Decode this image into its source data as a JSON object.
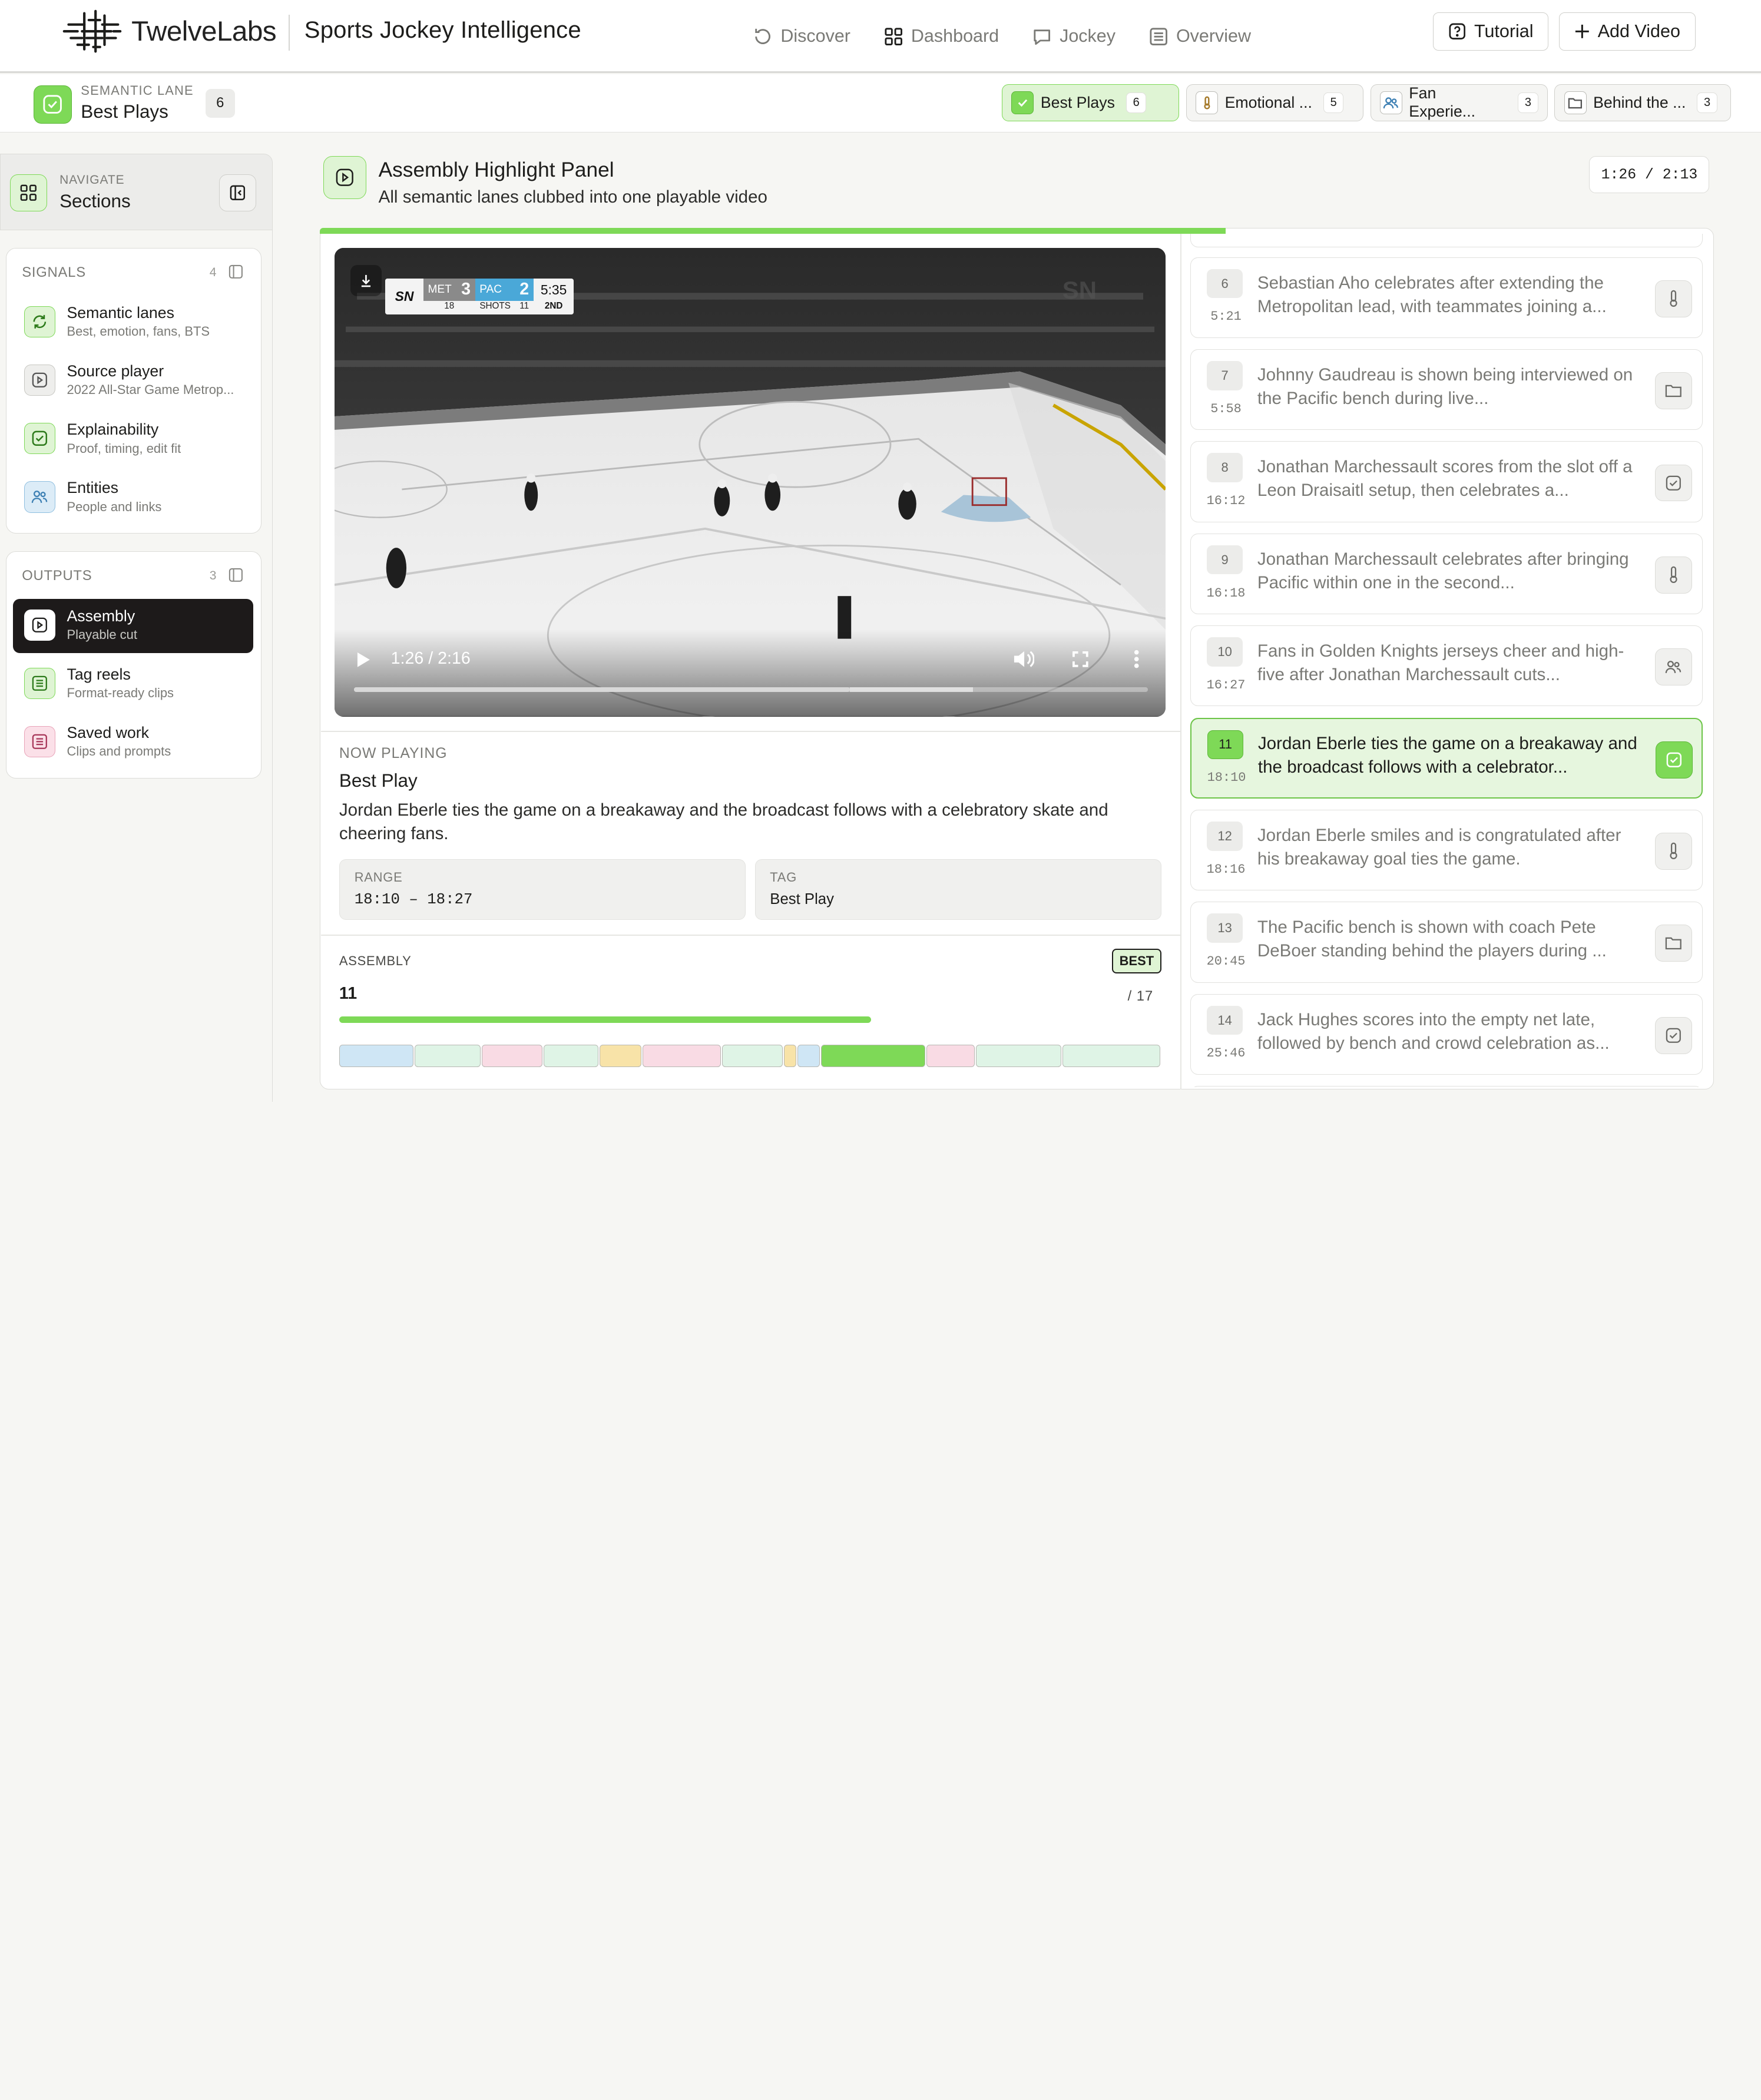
{
  "brand": {
    "name": "TwelveLabs",
    "app_title": "Sports Jockey Intelligence"
  },
  "nav": [
    {
      "label": "Discover",
      "icon": "refresh-chat-icon",
      "active": false
    },
    {
      "label": "Dashboard",
      "icon": "grid-icon",
      "active": true
    },
    {
      "label": "Jockey",
      "icon": "chat-bubble-icon",
      "active": false
    },
    {
      "label": "Overview",
      "icon": "list-icon",
      "active": false
    }
  ],
  "header_buttons": {
    "tutorial": "Tutorial",
    "add_video": "Add Video"
  },
  "lane": {
    "caption": "SEMANTIC LANE",
    "name": "Best Plays",
    "count": "6"
  },
  "lane_chips": [
    {
      "label": "Best Plays",
      "count": "6",
      "icon": "check-square-icon",
      "active": true
    },
    {
      "label": "Emotional ...",
      "count": "5",
      "icon": "thermometer-icon",
      "active": false
    },
    {
      "label": "Fan Experie...",
      "count": "3",
      "icon": "users-icon",
      "active": false
    },
    {
      "label": "Behind the ...",
      "count": "3",
      "icon": "folder-icon",
      "active": false
    }
  ],
  "sidebar": {
    "nav_caption": "NAVIGATE",
    "nav_title": "Sections",
    "signals": {
      "caption": "SIGNALS",
      "count": "4",
      "items": [
        {
          "title": "Semantic lanes",
          "subtitle": "Best, emotion, fans, BTS",
          "icon": "refresh-icon"
        },
        {
          "title": "Source player",
          "subtitle": "2022 All-Star Game Metrop...",
          "icon": "play-square-icon"
        },
        {
          "title": "Explainability",
          "subtitle": "Proof, timing, edit fit",
          "icon": "check-square-icon"
        },
        {
          "title": "Entities",
          "subtitle": "People and links",
          "icon": "users-icon"
        }
      ]
    },
    "outputs": {
      "caption": "OUTPUTS",
      "count": "3",
      "items": [
        {
          "title": "Assembly",
          "subtitle": "Playable cut",
          "icon": "play-square-icon",
          "active": true
        },
        {
          "title": "Tag reels",
          "subtitle": "Format-ready clips",
          "icon": "list-icon",
          "active": false
        },
        {
          "title": "Saved work",
          "subtitle": "Clips and prompts",
          "icon": "list-icon",
          "active": false
        }
      ]
    }
  },
  "panel": {
    "title": "Assembly Highlight Panel",
    "subtitle": "All semantic lanes clubbed into one playable video",
    "time": "1:26 / 2:13"
  },
  "video": {
    "time": "1:26 / 2:16",
    "progress": 0.625,
    "buffered": 0.78,
    "scorebug": {
      "network": "SN",
      "team1": "MET",
      "score1": "3",
      "team2": "PAC",
      "score2": "2",
      "clock": "5:35",
      "shots1": "18",
      "shots_label": "SHOTS",
      "shots2": "11",
      "period": "2ND"
    }
  },
  "now_playing": {
    "caption": "NOW PLAYING",
    "title": "Best Play",
    "description": "Jordan Eberle ties the game on a breakaway and the broadcast follows with a celebratory skate and cheering fans.",
    "range_label": "RANGE",
    "range_value": "18:10 – 18:27",
    "tag_label": "TAG",
    "tag_value": "Best Play"
  },
  "assembly": {
    "caption": "ASSEMBLY",
    "badge": "BEST",
    "current": "11",
    "total": "/ 17",
    "progress": 0.647,
    "segments": [
      {
        "color": "#cfe6f5"
      },
      {
        "color": "#dff4e6"
      },
      {
        "color": "#f9dbe4"
      },
      {
        "color": "#dff4e6"
      },
      {
        "color": "#f8e3a8"
      },
      {
        "color": "#f9dbe4"
      },
      {
        "color": "#dff4e6"
      },
      {
        "color": "#f8e3a8"
      },
      {
        "color": "#cfe6f5"
      },
      {
        "color": "#7ed957"
      },
      {
        "color": "#f9dbe4"
      },
      {
        "color": "#dff4e6"
      },
      {
        "color": "#dff4e6"
      }
    ]
  },
  "clips": [
    {
      "num": "6",
      "time": "5:21",
      "text": "Sebastian Aho celebrates after extending the Metropolitan lead, with teammates joining a...",
      "icon": "thermometer-icon",
      "active": false
    },
    {
      "num": "7",
      "time": "5:58",
      "text": "Johnny Gaudreau is shown being interviewed on the Pacific bench during live...",
      "icon": "folder-icon",
      "active": false
    },
    {
      "num": "8",
      "time": "16:12",
      "text": "Jonathan Marchessault scores from the slot off a Leon Draisaitl setup, then celebrates a...",
      "icon": "check-square-icon",
      "active": false
    },
    {
      "num": "9",
      "time": "16:18",
      "text": "Jonathan Marchessault celebrates after bringing Pacific within one in the second...",
      "icon": "thermometer-icon",
      "active": false
    },
    {
      "num": "10",
      "time": "16:27",
      "text": "Fans in Golden Knights jerseys cheer and high-five after Jonathan Marchessault cuts...",
      "icon": "users-icon",
      "active": false
    },
    {
      "num": "11",
      "time": "18:10",
      "text": "Jordan Eberle ties the game on a breakaway and the broadcast follows with a celebrator...",
      "icon": "check-square-icon",
      "active": true
    },
    {
      "num": "12",
      "time": "18:16",
      "text": "Jordan Eberle smiles and is congratulated after his breakaway goal ties the game.",
      "icon": "thermometer-icon",
      "active": false
    },
    {
      "num": "13",
      "time": "20:45",
      "text": "The Pacific bench is shown with coach Pete DeBoer standing behind the players during ...",
      "icon": "folder-icon",
      "active": false
    },
    {
      "num": "14",
      "time": "25:46",
      "text": "Jack Hughes scores into the empty net late, followed by bench and crowd celebration as...",
      "icon": "check-square-icon",
      "active": false
    }
  ]
}
